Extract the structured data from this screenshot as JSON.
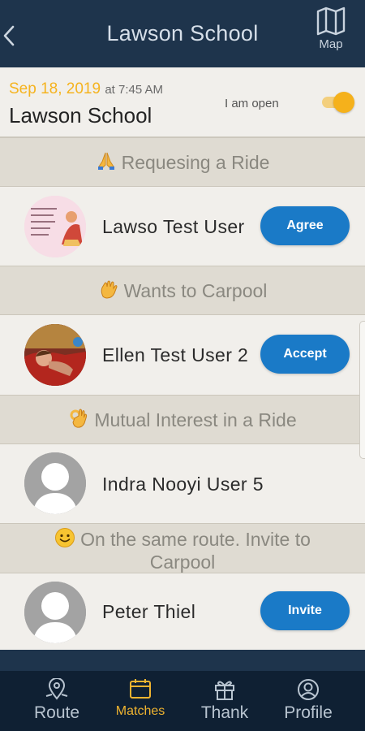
{
  "header": {
    "title": "Lawson School",
    "map_label": "Map"
  },
  "event": {
    "date": "Sep 18, 2019",
    "time": "at 7:45 AM",
    "name": "Lawson School",
    "open_label": "I am open",
    "is_open": true
  },
  "sections": [
    {
      "title": "Requesing a Ride",
      "emoji": "folded-hands",
      "user": {
        "name": "Lawso Test User",
        "avatar": "photo-pink-card",
        "action": "Agree"
      }
    },
    {
      "title": "Wants to Carpool",
      "emoji": "waving-hand",
      "user": {
        "name": "Ellen Test User 2",
        "avatar": "photo-child-red-couch",
        "action": "Accept"
      }
    },
    {
      "title": "Mutual Interest in a Ride",
      "emoji": "ok-hand",
      "user": {
        "name": "Indra Nooyi User 5",
        "avatar": "default-avatar",
        "action": ""
      }
    },
    {
      "title_line1": "On the same route. Invite to",
      "title_line2": "Carpool",
      "emoji": "smiling-face",
      "user": {
        "name": "Peter Thiel",
        "avatar": "default-avatar",
        "action": "Invite"
      }
    }
  ],
  "tabs": [
    {
      "label": "Route",
      "icon": "map-pin-icon",
      "active": false
    },
    {
      "label": "Matches",
      "icon": "calendar-icon",
      "active": true
    },
    {
      "label": "Thank",
      "icon": "gift-icon",
      "active": false
    },
    {
      "label": "Profile",
      "icon": "user-circle-icon",
      "active": false
    }
  ],
  "colors": {
    "header_bg": "#1e344c",
    "tabbar_bg": "#0f2033",
    "accent_yellow": "#f5b31e",
    "button_blue": "#1a7ac7",
    "section_bg": "#dfdbd2",
    "row_bg": "#f1efeb"
  }
}
